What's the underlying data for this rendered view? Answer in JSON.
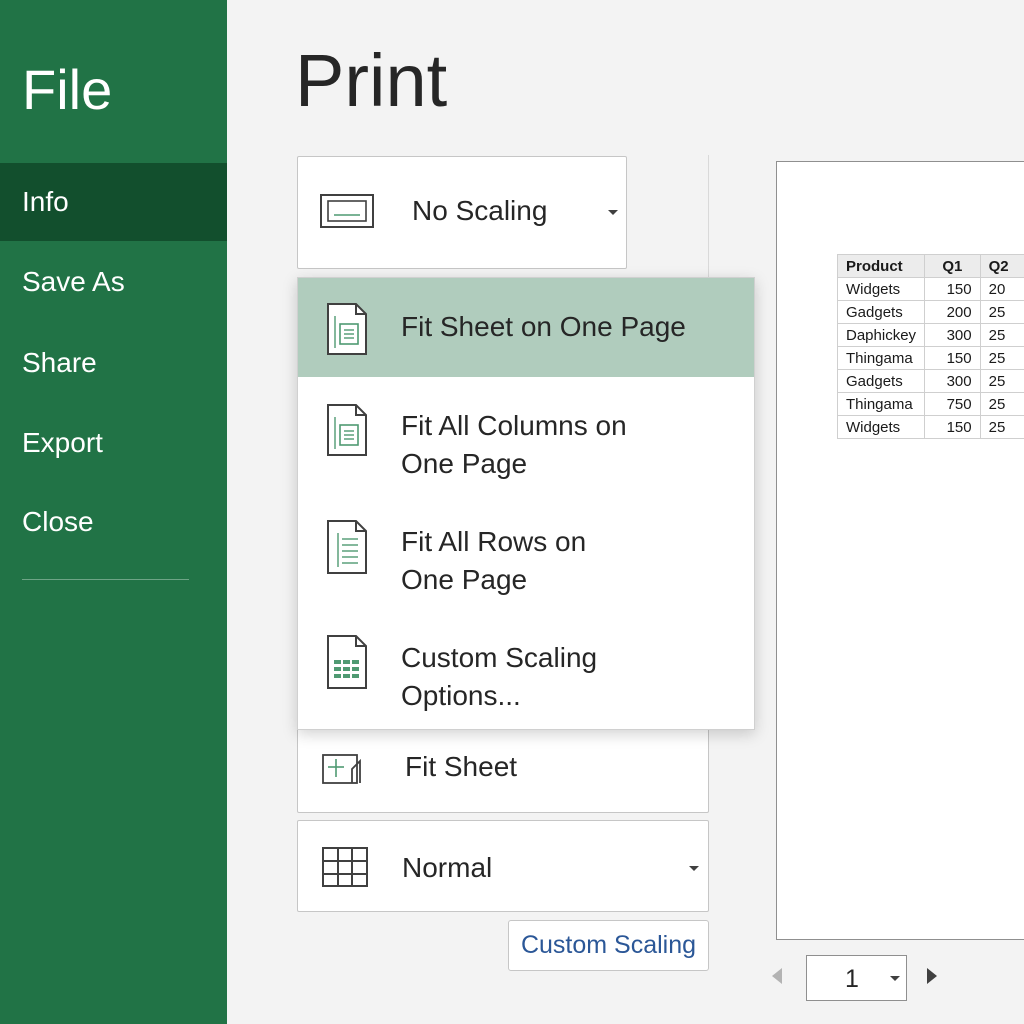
{
  "sidebar": {
    "title": "File",
    "items": [
      {
        "label": "Info"
      },
      {
        "label": "Save As"
      },
      {
        "label": "Share"
      },
      {
        "label": "Export"
      },
      {
        "label": "Close"
      }
    ],
    "active": "Info"
  },
  "page": {
    "heading": "Print"
  },
  "scaling": {
    "selected_label": "No Scaling"
  },
  "scaling_menu": {
    "items": [
      {
        "line1": "Fit Sheet on One Page",
        "line2": "",
        "icon": "fit-sheet-page-icon",
        "selected": true
      },
      {
        "line1": "Fit All Columns on",
        "line2": "One Page",
        "icon": "fit-columns-page-icon",
        "selected": false
      },
      {
        "line1": "Fit All Rows on",
        "line2": "One Page",
        "icon": "fit-rows-page-icon",
        "selected": false
      },
      {
        "line1": "Custom Scaling",
        "line2": "Options...",
        "icon": "custom-scaling-page-icon",
        "selected": false
      }
    ]
  },
  "fit_sheet": {
    "label": "Fit Sheet"
  },
  "margins": {
    "label": "Normal"
  },
  "custom_scaling_button": {
    "label": "Custom Scaling"
  },
  "preview_table": {
    "headers": [
      "Product",
      "Q1",
      "Q2"
    ],
    "rows": [
      [
        "Widgets",
        "150",
        "20"
      ],
      [
        "Gadgets",
        "200",
        "25"
      ],
      [
        "Daphickey",
        "300",
        "25"
      ],
      [
        "Thingama",
        "150",
        "25"
      ],
      [
        "Gadgets",
        "300",
        "25"
      ],
      [
        "Thingama",
        "750",
        "25"
      ],
      [
        "Widgets",
        "150",
        "25"
      ]
    ]
  },
  "pager": {
    "current_page": "1"
  },
  "colors": {
    "sidebar_bg": "#217346",
    "sidebar_active_bg": "#124f2d",
    "menu_selected_bg": "#b0ccbd",
    "link_text": "#2b5797",
    "icon_green": "#4f9a72"
  }
}
